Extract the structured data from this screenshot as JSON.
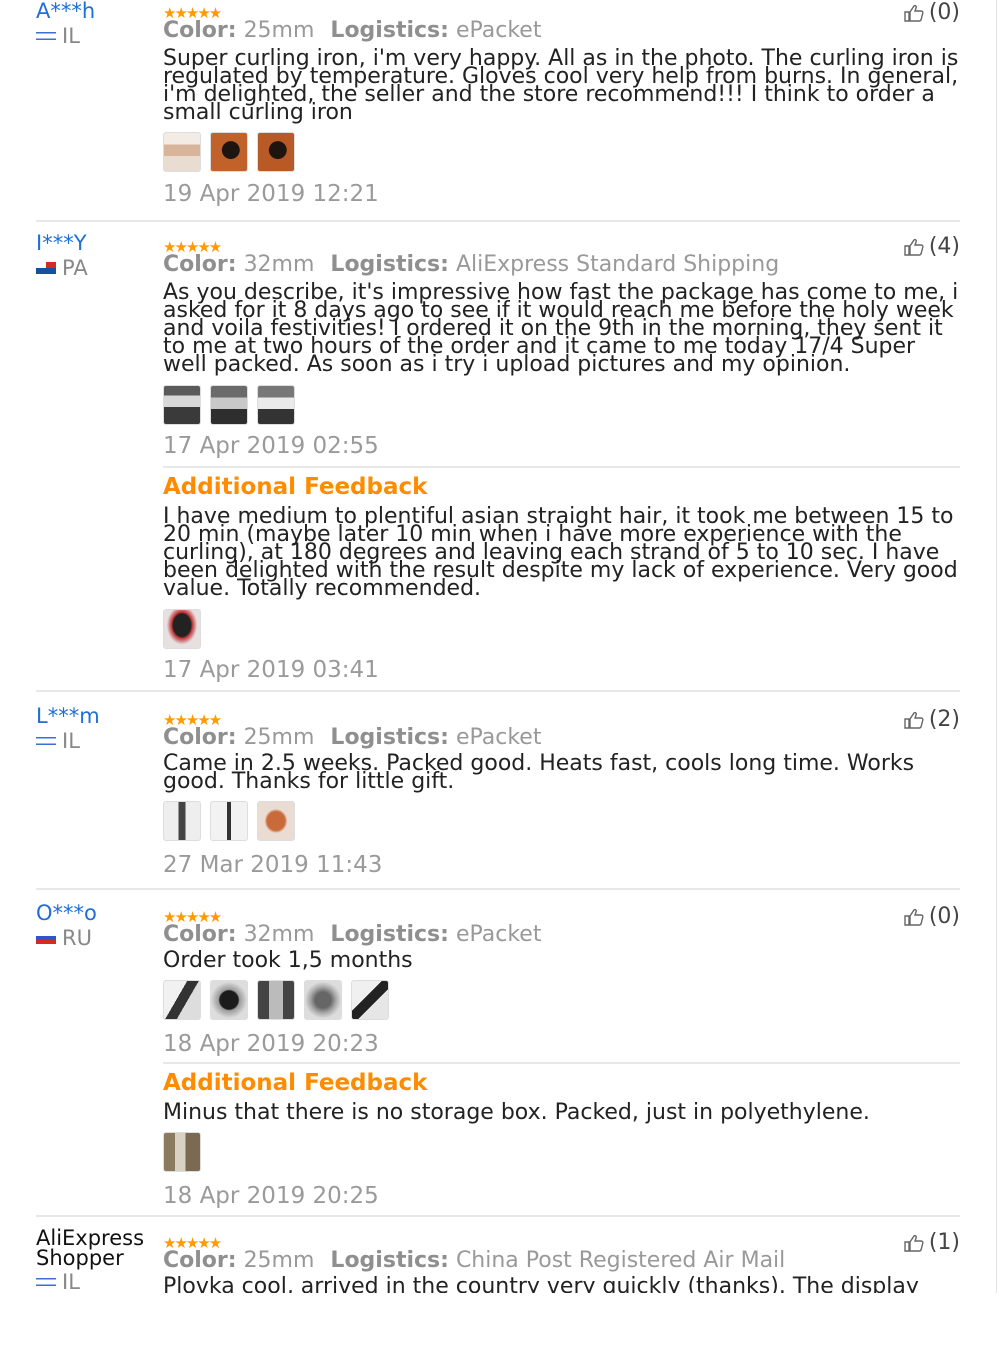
{
  "icons": {
    "rating": "star-rating-icon",
    "helpful": "thumbs-up-icon"
  },
  "colors": {
    "username": "#1f6fd6",
    "stars": "#ff9a00",
    "additional_feedback": "#ff8c00"
  },
  "labels": {
    "color": "Color:",
    "logistics": "Logistics:",
    "additional_feedback": "Additional Feedback"
  },
  "reviews": [
    {
      "user": "A***h",
      "country": "IL",
      "helpful": "(0)",
      "rating": 5,
      "color": "25mm",
      "logistics": "ePacket",
      "text": "Super curling iron, i'm very happy. All as in the photo. The curling iron is regulated by temperature. Gloves cool very help from burns. In general, i'm delighted, the seller and the store recommend!!! I think to order a small curling iron",
      "photo_count": 3,
      "date": "19 Apr 2019 12:21"
    },
    {
      "user": "I***Y",
      "country": "PA",
      "helpful": "(4)",
      "rating": 5,
      "color": "32mm",
      "logistics": "AliExpress Standard Shipping",
      "text": "As you describe, it's impressive how fast the package has come to me, i asked for it 8 days ago to see if it would reach me before the holy week and voila festivities! I ordered it on the 9th in the morning, they sent it to me at two hours of the order and it came to me today 17/4 Super well packed. As soon as i try i upload pictures and my opinion.",
      "photo_count": 3,
      "date": "17 Apr 2019 02:55",
      "additional": {
        "text": "I have medium to plentiful asian straight hair, it took me between 15 to 20 min (maybe later 10 min when i have more experience with the curling), at 180 degrees and leaving each strand of 5 to 10 sec. I have been delighted with the result despite my lack of experience. Very good value. Totally recommended.",
        "photo_count": 1,
        "date": "17 Apr 2019 03:41"
      }
    },
    {
      "user": "L***m",
      "country": "IL",
      "helpful": "(2)",
      "rating": 5,
      "color": "25mm",
      "logistics": "ePacket",
      "text": "Came in 2.5 weeks. Packed good. Heats fast, cools long time. Works good. Thanks for little gift.",
      "photo_count": 3,
      "date": "27 Mar 2019 11:43"
    },
    {
      "user": "O***o",
      "country": "RU",
      "helpful": "(0)",
      "rating": 5,
      "color": "32mm",
      "logistics": "ePacket",
      "text": "Order took 1,5 months",
      "photo_count": 5,
      "date": "18 Apr 2019 20:23",
      "additional": {
        "text": "Minus that there is no storage box. Packed, just in polyethylene.",
        "photo_count": 1,
        "date": "18 Apr 2019 20:25"
      }
    },
    {
      "user": "AliExpress Shopper",
      "country": "IL",
      "helpful": "(1)",
      "rating": 5,
      "color": "25mm",
      "logistics": "China Post Registered Air Mail",
      "text": "Plovka cool, arrived in the country very quickly (thanks). The display"
    }
  ]
}
